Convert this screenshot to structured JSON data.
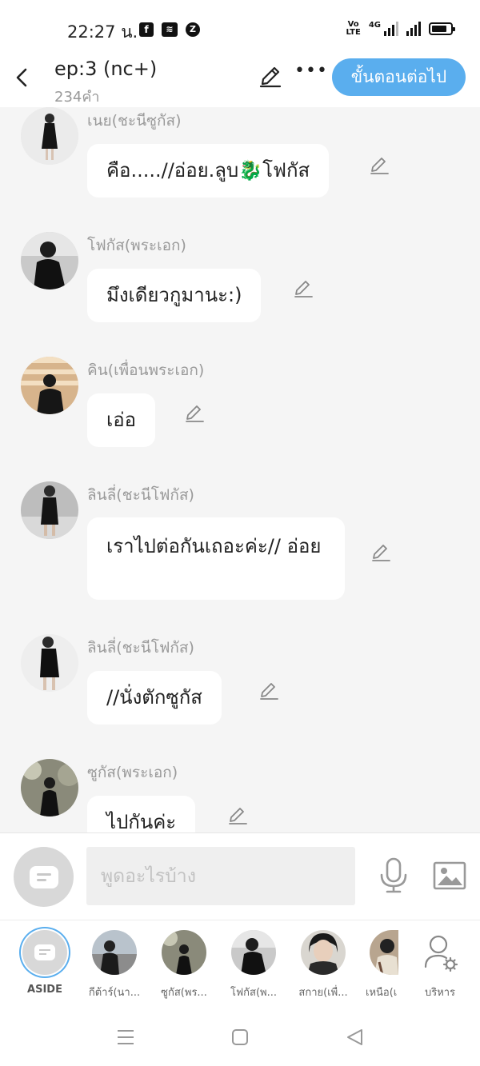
{
  "status_bar": {
    "time": "22:27 น.",
    "apps": [
      "f",
      "≋",
      "Z"
    ],
    "volte": "Vo\nLTE",
    "network": "4G"
  },
  "header": {
    "title": "ep:3 (nc+)",
    "word_count": "234คำ",
    "next_label": "ขั้นตอนต่อไป"
  },
  "messages": [
    {
      "speaker": "เนย(ชะนีซูกัส)",
      "text": "คือ.....//อ่อย.ลูบ🐉โฟกัส"
    },
    {
      "speaker": "โฟกัส(พระเอก)",
      "text": "มึงเดียวกูมานะ:)"
    },
    {
      "speaker": "คิน(เพื่อนพระเอก)",
      "text": "เอ่อ"
    },
    {
      "speaker": "ลินลี่(ชะนีโฟกัส)",
      "text": "เราไปต่อกันเถอะค่ะ// อ่อย"
    },
    {
      "speaker": "ลินลี่(ชะนีโฟกัส)",
      "text": "//นั่งตักซูกัส"
    },
    {
      "speaker": "ซูกัส(พระเอก)",
      "text": "ไปกันค่ะ"
    }
  ],
  "input": {
    "placeholder": "พูดอะไรบ้าง"
  },
  "characters": [
    {
      "label": "ASIDE"
    },
    {
      "label": "กีต้าร์(นา..."
    },
    {
      "label": "ซูกัส(พร..."
    },
    {
      "label": "โฟกัส(พ..."
    },
    {
      "label": "สกาย(เพื่..."
    },
    {
      "label": "เหนือ(เ"
    },
    {
      "label": "บริหาร"
    }
  ]
}
